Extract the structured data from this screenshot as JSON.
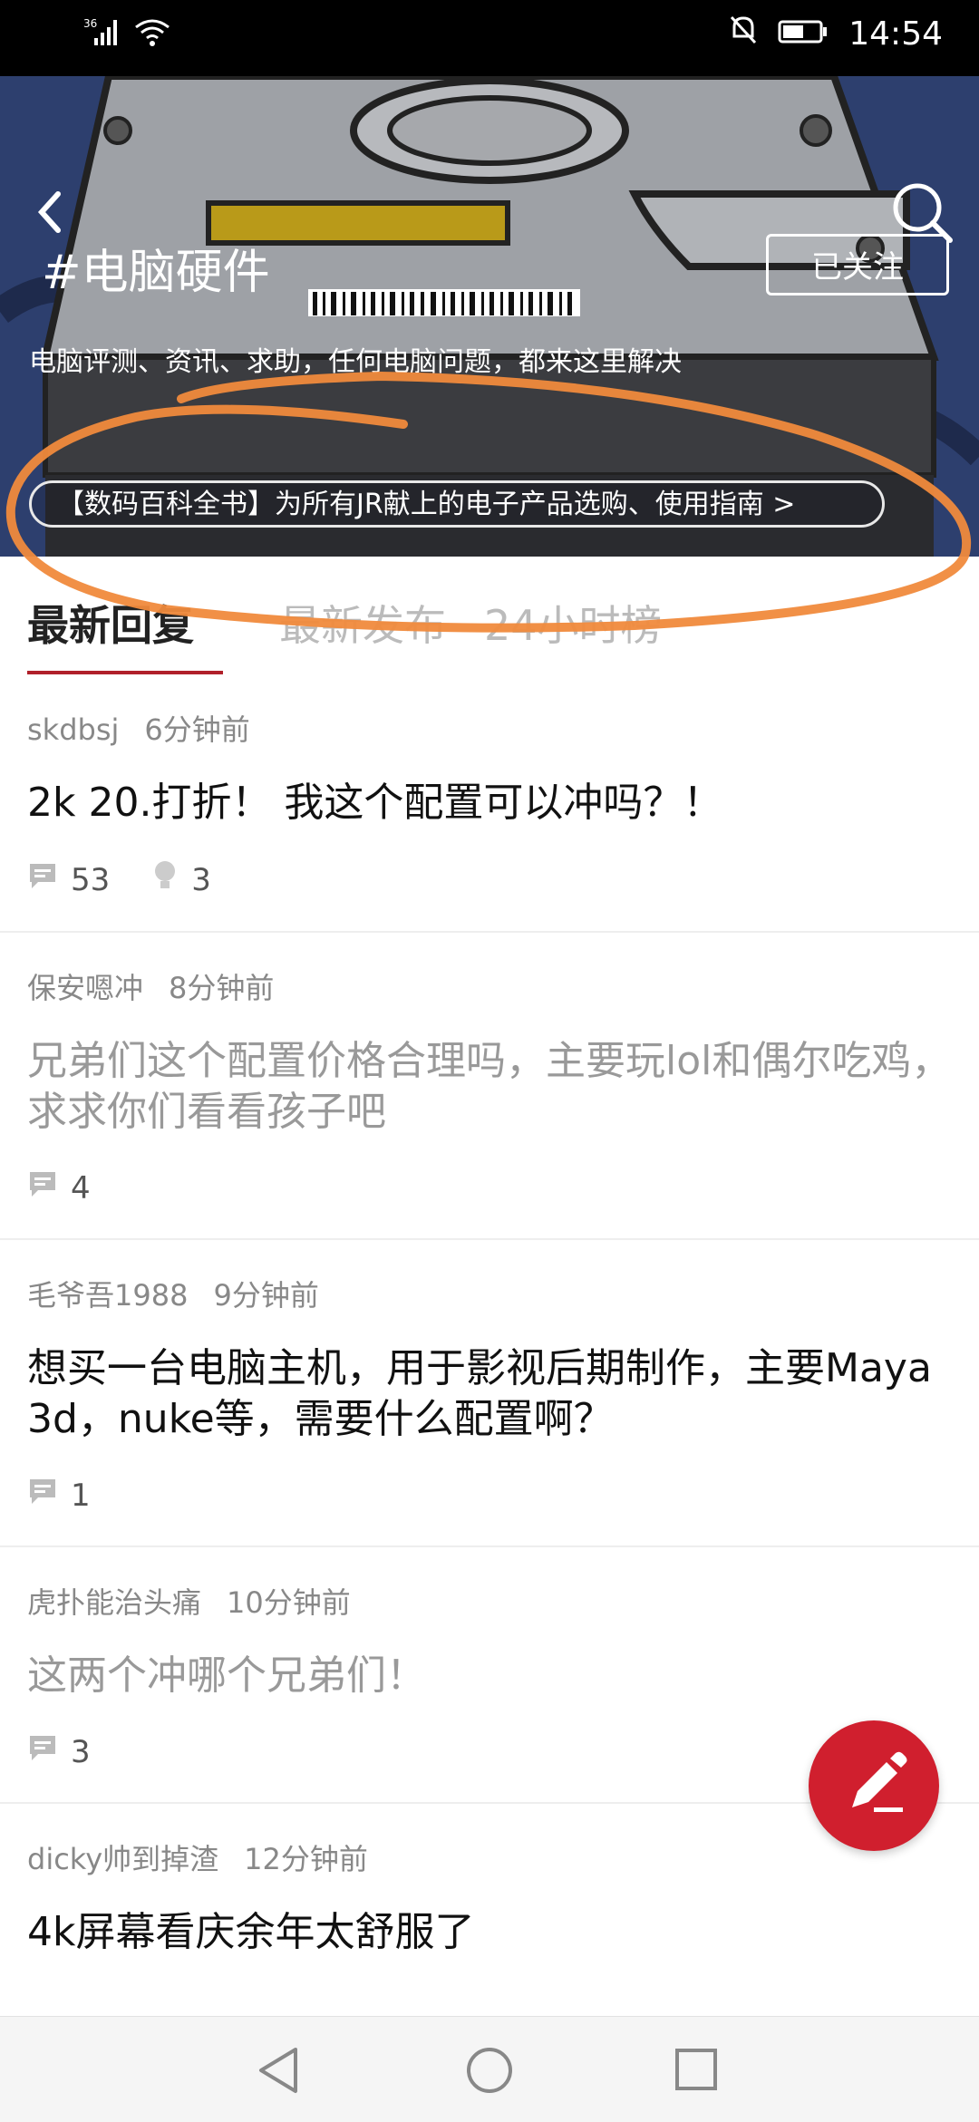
{
  "status_bar": {
    "network": "36",
    "time": "14:54"
  },
  "header": {
    "title": "#电脑硬件",
    "follow_label": "已关注",
    "description": "电脑评测、资讯、求助，任何电脑问题，都来这里解决",
    "guide_link": "【数码百科全书】为所有JR献上的电子产品选购、使用指南 >"
  },
  "tabs": [
    {
      "label": "最新回复"
    },
    {
      "label": "最新发布"
    },
    {
      "label": "24小时榜"
    }
  ],
  "posts": [
    {
      "author": "skdbsj",
      "time": "6分钟前",
      "title": "2k 20.打折！  我这个配置可以冲吗？！",
      "comments": "53",
      "likes": "3"
    },
    {
      "author": "保安嗯冲",
      "time": "8分钟前",
      "title": "兄弟们这个配置价格合理吗，主要玩lol和偶尔吃鸡，求求你们看看孩子吧",
      "comments": "4"
    },
    {
      "author": "毛爷吾1988",
      "time": "9分钟前",
      "title": "想买一台电脑主机，用于影视后期制作，主要Maya 3d，nuke等，需要什么配置啊？",
      "comments": "1"
    },
    {
      "author": "虎扑能治头痛",
      "time": "10分钟前",
      "title": "这两个冲哪个兄弟们！",
      "comments": "3"
    },
    {
      "author": "dicky帅到掉渣",
      "time": "12分钟前",
      "title": "4k屏幕看庆余年太舒服了"
    }
  ],
  "colors": {
    "accent": "#d01f2e",
    "tab_underline": "#b0202a",
    "annotation": "#f08a3c",
    "banner_bg": "#2d3f6e"
  }
}
